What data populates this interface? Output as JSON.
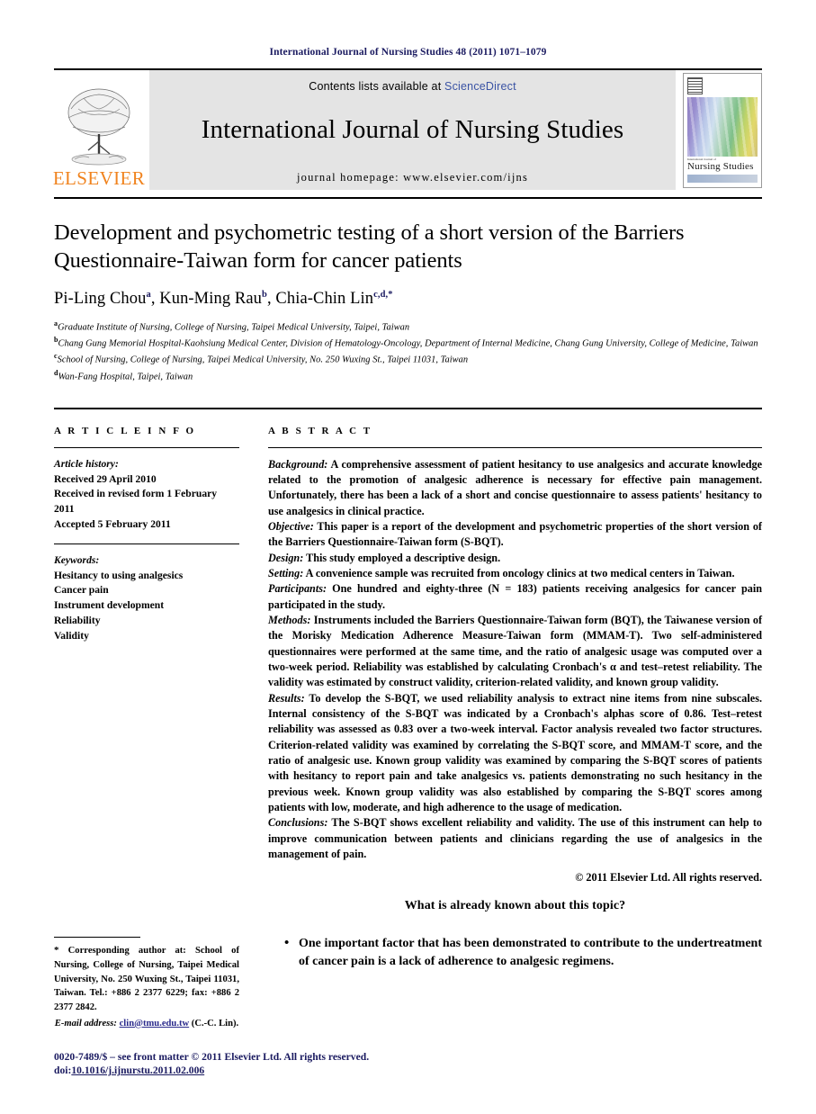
{
  "running_head": "International Journal of Nursing Studies 48 (2011) 1071–1079",
  "masthead": {
    "contents_prefix": "Contents lists available at ",
    "sciencedirect": "ScienceDirect",
    "journal_title": "International Journal of Nursing Studies",
    "homepage": "journal homepage: www.elsevier.com/ijns",
    "publisher_wordmark": "ELSEVIER",
    "publisher_color": "#F0831E",
    "link_color": "#3a53a4",
    "cover": {
      "small_line": "International Journal of",
      "name": "Nursing Studies"
    }
  },
  "article": {
    "title": "Development and psychometric testing of a short version of the Barriers Questionnaire-Taiwan form for cancer patients",
    "authors": [
      {
        "name": "Pi-Ling Chou",
        "marks": "a"
      },
      {
        "name": "Kun-Ming Rau",
        "marks": "b"
      },
      {
        "name": "Chia-Chin Lin",
        "marks": "c,d,*"
      }
    ],
    "affiliations": [
      {
        "mark": "a",
        "text": "Graduate Institute of Nursing, College of Nursing, Taipei Medical University, Taipei, Taiwan"
      },
      {
        "mark": "b",
        "text": "Chang Gung Memorial Hospital-Kaohsiung Medical Center, Division of Hematology-Oncology, Department of Internal Medicine, Chang Gung University, College of Medicine, Taiwan"
      },
      {
        "mark": "c",
        "text": "School of Nursing, College of Nursing, Taipei Medical University, No. 250 Wuxing St., Taipei 11031, Taiwan"
      },
      {
        "mark": "d",
        "text": "Wan-Fang Hospital, Taipei, Taiwan"
      }
    ]
  },
  "article_info": {
    "heading": "A R T I C L E   I N F O",
    "history_label": "Article history:",
    "history": [
      "Received 29 April 2010",
      "Received in revised form 1 February 2011",
      "Accepted 5 February 2011"
    ],
    "keywords_label": "Keywords:",
    "keywords": [
      "Hesitancy to using analgesics",
      "Cancer pain",
      "Instrument development",
      "Reliability",
      "Validity"
    ]
  },
  "abstract": {
    "heading": "A B S T R A C T",
    "sections": [
      {
        "label": "Background:",
        "text": " A comprehensive assessment of patient hesitancy to use analgesics and accurate knowledge related to the promotion of analgesic adherence is necessary for effective pain management. Unfortunately, there has been a lack of a short and concise questionnaire to assess patients' hesitancy to use analgesics in clinical practice."
      },
      {
        "label": "Objective:",
        "text": " This paper is a report of the development and psychometric properties of the short version of the Barriers Questionnaire-Taiwan form (S-BQT)."
      },
      {
        "label": "Design:",
        "text": " This study employed a descriptive design."
      },
      {
        "label": "Setting:",
        "text": " A convenience sample was recruited from oncology clinics at two medical centers in Taiwan."
      },
      {
        "label": "Participants:",
        "text": " One hundred and eighty-three (N = 183) patients receiving analgesics for cancer pain participated in the study."
      },
      {
        "label": "Methods:",
        "text": " Instruments included the Barriers Questionnaire-Taiwan form (BQT), the Taiwanese version of the Morisky Medication Adherence Measure-Taiwan form (MMAM-T). Two self-administered questionnaires were performed at the same time, and the ratio of analgesic usage was computed over a two-week period. Reliability was established by calculating Cronbach's α and test–retest reliability. The validity was estimated by construct validity, criterion-related validity, and known group validity."
      },
      {
        "label": "Results:",
        "text": " To develop the S-BQT, we used reliability analysis to extract nine items from nine subscales. Internal consistency of the S-BQT was indicated by a Cronbach's alphas score of 0.86. Test–retest reliability was assessed as 0.83 over a two-week interval. Factor analysis revealed two factor structures. Criterion-related validity was examined by correlating the S-BQT score, and MMAM-T score, and the ratio of analgesic use. Known group validity was examined by comparing the S-BQT scores of patients with hesitancy to report pain and take analgesics vs. patients demonstrating no such hesitancy in the previous week. Known group validity was also established by comparing the S-BQT scores among patients with low, moderate, and high adherence to the usage of medication."
      },
      {
        "label": "Conclusions:",
        "text": " The S-BQT shows excellent reliability and validity. The use of this instrument can help to improve communication between patients and clinicians regarding the use of analgesics in the management of pain."
      }
    ],
    "copyright": "© 2011 Elsevier Ltd. All rights reserved."
  },
  "known_box": {
    "heading": "What is already known about this topic?",
    "items": [
      "One important factor that has been demonstrated to contribute to the undertreatment of cancer pain is a lack of adherence to analgesic regimens."
    ]
  },
  "corresponding": {
    "star": "*",
    "text": "Corresponding author at: School of Nursing, College of Nursing, Taipei Medical University, No. 250 Wuxing St., Taipei 11031, Taiwan. Tel.: +886 2 2377 6229; fax: +886 2 2377 2842.",
    "email_label": "E-mail address:",
    "email": "clin@tmu.edu.tw",
    "email_suffix": " (C.-C. Lin)."
  },
  "footer": {
    "issn_line": "0020-7489/$ – see front matter © 2011 Elsevier Ltd. All rights reserved.",
    "doi_prefix": "doi:",
    "doi": "10.1016/j.ijnurstu.2011.02.006"
  }
}
